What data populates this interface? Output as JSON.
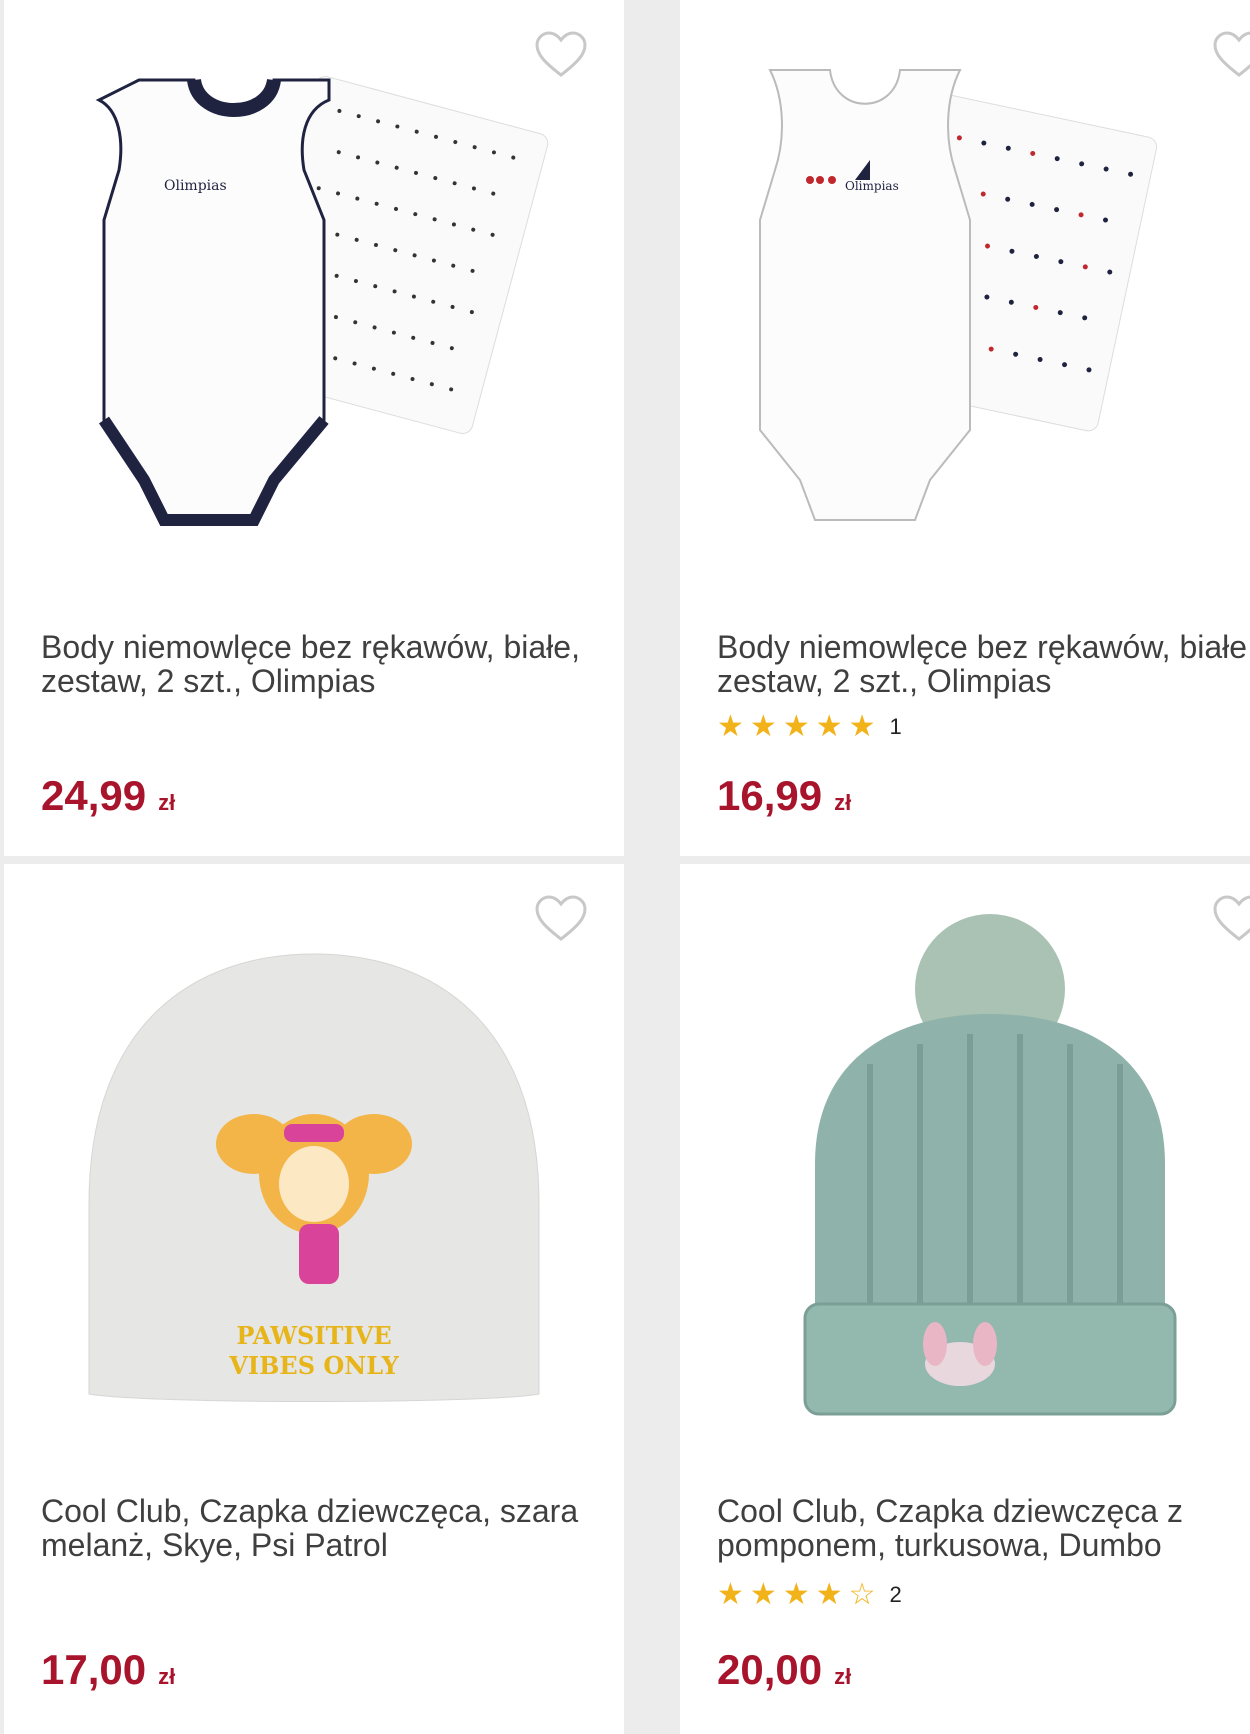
{
  "products": [
    {
      "title": "Body niemowlęce bez rękawów, białe, zestaw, 2 szt., Olimpias",
      "price": "24,99",
      "currency": "zł",
      "rating_count": null,
      "image_icon": "baby-bodysuit-set-image"
    },
    {
      "title": "Body niemowlęce bez rękawów, białe, zestaw, 2 szt., Olimpias",
      "price": "16,99",
      "currency": "zł",
      "rating_stars": 5,
      "rating_count": "1",
      "image_icon": "baby-bodysuit-set-image"
    },
    {
      "title": "Cool Club, Czapka dziewczęca, szara melanż, Skye, Psi Patrol",
      "price": "17,00",
      "currency": "zł",
      "rating_count": null,
      "image_icon": "grey-beanie-image"
    },
    {
      "title": "Cool Club, Czapka dziewczęca z pomponem, turkusowa, Dumbo",
      "price": "20,00",
      "currency": "zł",
      "rating_stars": 4,
      "rating_count": "2",
      "image_icon": "turquoise-pompom-hat-image"
    }
  ],
  "colors": {
    "price": "#a8142b",
    "star": "#f2b21a",
    "background": "#ececec"
  }
}
